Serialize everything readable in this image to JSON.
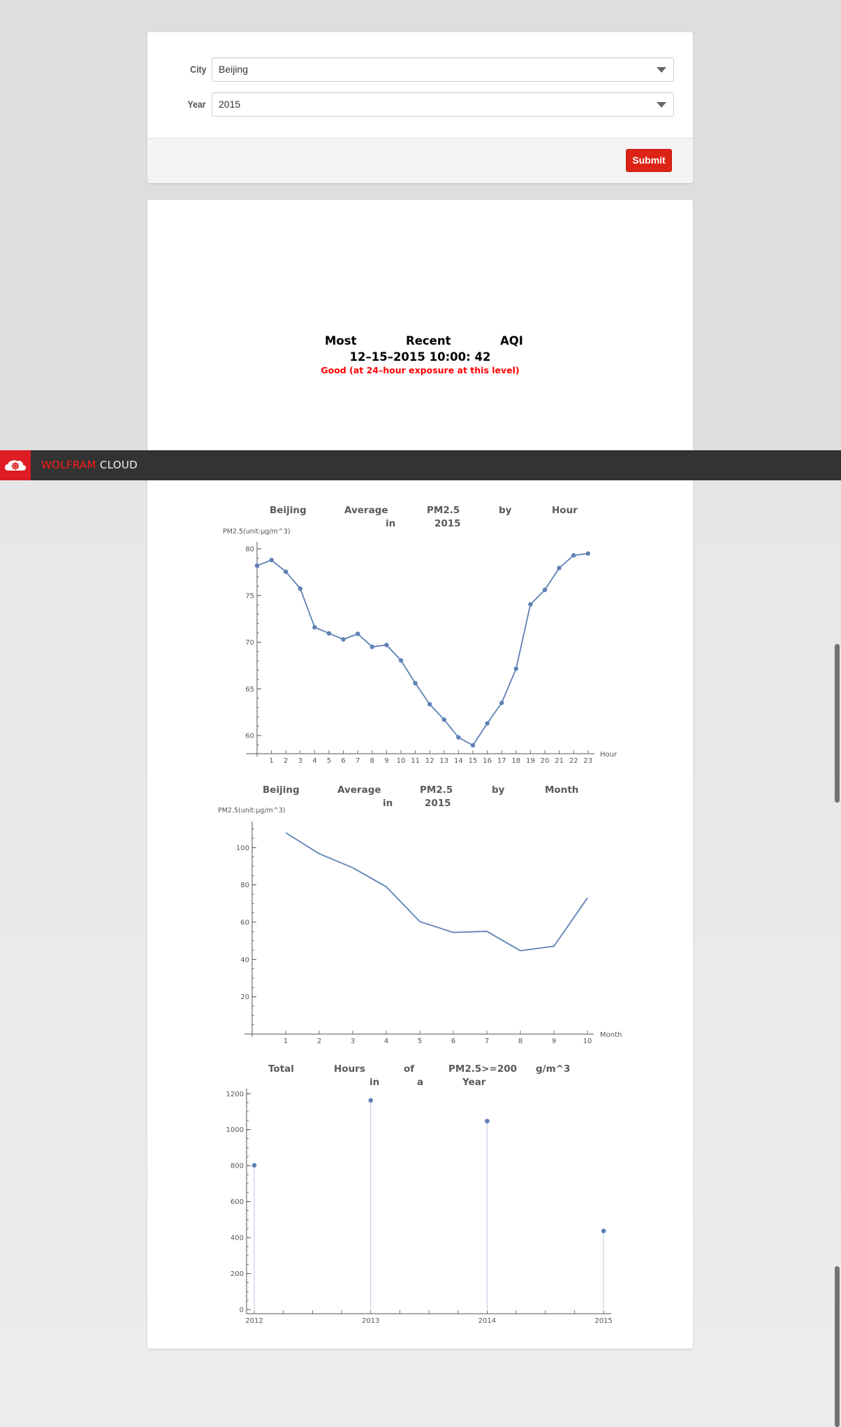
{
  "form": {
    "city_label": "City",
    "city_value": "Beijing",
    "year_label": "Year",
    "year_value": "2015",
    "submit_label": "Submit"
  },
  "aqi": {
    "title_words": [
      "Most",
      "Recent",
      "AQI"
    ],
    "reading": "12–15–2015 10:00: 42",
    "status": "Good (at 24–hour exposure at this level)",
    "status_color": "#ff0000"
  },
  "wolfram_bar": {
    "brand_red": "WOLFRAM",
    "brand_white": " CLOUD",
    "icon": "wolfram-cloud-icon",
    "accent": "#dd1c24"
  },
  "colors": {
    "series": "#5e81b5",
    "submit": "#dd2316"
  },
  "chart_data": [
    {
      "type": "line",
      "title_line1": [
        "Beijing",
        "Average",
        "PM2.5",
        "by",
        "Hour"
      ],
      "title_line2": [
        "in",
        "2015"
      ],
      "xlabel": "Hour",
      "ylabel": "PM2.5(unit:μg/m^3)",
      "markers": true,
      "x": [
        0,
        1,
        2,
        3,
        4,
        5,
        6,
        7,
        8,
        9,
        10,
        11,
        12,
        13,
        14,
        15,
        16,
        17,
        18,
        19,
        20,
        21,
        22,
        23
      ],
      "values": [
        78.2,
        78.8,
        77.55,
        75.75,
        71.6,
        70.95,
        70.3,
        70.9,
        69.5,
        69.7,
        68.05,
        65.6,
        63.35,
        61.7,
        59.8,
        58.95,
        61.3,
        63.5,
        67.15,
        74.05,
        75.6,
        77.95,
        79.3,
        79.5
      ],
      "xticks": [
        "1",
        "2",
        "3",
        "4",
        "5",
        "6",
        "7",
        "8",
        "9",
        "10",
        "11",
        "12",
        "13",
        "14",
        "15",
        "16",
        "17",
        "18",
        "19",
        "20",
        "21",
        "22",
        "23"
      ],
      "yticks": [
        "60",
        "65",
        "70",
        "75",
        "80"
      ],
      "ylim": [
        58.2,
        80.5
      ],
      "xlim": [
        0,
        23
      ]
    },
    {
      "type": "line",
      "title_line1": [
        "Beijing",
        "Average",
        "PM2.5",
        "by",
        "Month"
      ],
      "title_line2": [
        "in",
        "2015"
      ],
      "xlabel": "Month",
      "ylabel": "PM2.5(unit:μg/m^3)",
      "markers": false,
      "x": [
        1,
        2,
        3,
        4,
        5,
        6,
        7,
        8,
        9,
        10
      ],
      "values": [
        108.0,
        96.7,
        89.2,
        79.0,
        60.3,
        54.5,
        55.1,
        44.7,
        47.1,
        73.0
      ],
      "xticks": [
        "1",
        "2",
        "3",
        "4",
        "5",
        "6",
        "7",
        "8",
        "9",
        "10"
      ],
      "yticks": [
        "20",
        "40",
        "60",
        "80",
        "100"
      ],
      "ylim": [
        0,
        113
      ],
      "xlim": [
        0,
        10
      ]
    },
    {
      "type": "scatter",
      "style": "stem",
      "title_line1": [
        "Total",
        "Hours",
        "of",
        "PM2.5>=200",
        "g/m^3"
      ],
      "title_line2": [
        "in",
        "a",
        "Year"
      ],
      "xlabel": "",
      "ylabel": "",
      "x": [
        2012,
        2013,
        2014,
        2015
      ],
      "values": [
        802,
        1163,
        1048,
        437
      ],
      "xticks": [
        "2012",
        "2013",
        "2014",
        "2015"
      ],
      "yticks": [
        "0",
        "200",
        "400",
        "600",
        "800",
        "1000",
        "1200"
      ],
      "ylim": [
        0,
        1230
      ],
      "xlim": [
        2012,
        2015
      ]
    }
  ]
}
